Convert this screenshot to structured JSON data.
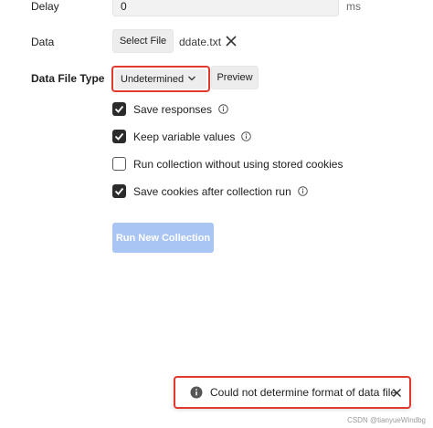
{
  "delay": {
    "label": "Delay",
    "value": "0",
    "unit": "ms"
  },
  "data": {
    "label": "Data",
    "select_file_label": "Select File",
    "filename": "ddate.txt"
  },
  "data_file_type": {
    "label": "Data File Type",
    "selected": "Undetermined",
    "preview_label": "Preview"
  },
  "options": [
    {
      "label": "Save responses",
      "checked": true,
      "info": true
    },
    {
      "label": "Keep variable values",
      "checked": true,
      "info": true
    },
    {
      "label": "Run collection without using stored cookies",
      "checked": false,
      "info": false
    },
    {
      "label": "Save cookies after collection run",
      "checked": true,
      "info": true
    }
  ],
  "run_button_label": "Run New Collection",
  "toast": {
    "message": "Could not determine format of data file"
  },
  "watermark": "CSDN @tianyueWindbg",
  "colors": {
    "highlight": "#e23b2e",
    "run_button": "#a9c5f4",
    "checkbox": "#2b2b2b"
  }
}
